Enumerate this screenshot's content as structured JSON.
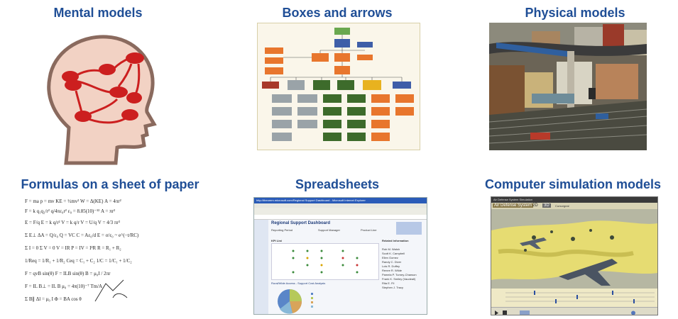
{
  "panels": [
    {
      "title": "Mental models",
      "image": "head-with-connected-nodes"
    },
    {
      "title": "Boxes and arrows",
      "image": "organization-chart"
    },
    {
      "title": "Physical models",
      "image": "model-railway-city"
    },
    {
      "title": "Formulas on a sheet of paper",
      "image": "physics-formulas"
    },
    {
      "title": "Spreadsheets",
      "image": "regional-support-dashboard"
    },
    {
      "title": "Computer simulation models",
      "image": "air-defense-simulation"
    }
  ],
  "colors": {
    "title": "#1f4e96",
    "node": "#cc1f1f",
    "head_fill": "#f2d2c4",
    "head_stroke": "#8a6a5e"
  },
  "spreadsheet": {
    "window_title": "http://theorem.microsoft.com/Regional Support Dashboard - Microsoft Internet Explorer",
    "page_title": "Regional Support Dashboard",
    "support_period_label": "Reporting Period",
    "support_manager_label": "Support Manager",
    "product_line_label": "Product Line",
    "kpi_list_label": "KPI List",
    "related_info_label": "Related Information",
    "chart_label": "Rural/Wide Access - Support Cost Analysis",
    "people": [
      "Rob M. Walsh",
      "Scott K. Campbell",
      "Ellen Gomez",
      "Randy C. Diver",
      "Lois R. Duffey",
      "Renee R. Wilde",
      "Pamela P. Turney-Chanson",
      "Frank K. Smiley (Vaudeall)",
      "Rita E. Fil",
      "Stephen J. Tracy"
    ]
  },
  "simulation": {
    "window_title": "Air Defense System Simulation",
    "tab_label": "Air Defense System",
    "view_2d": "2D",
    "view_3d": "3D",
    "radio_label": "Cursorgeal"
  }
}
